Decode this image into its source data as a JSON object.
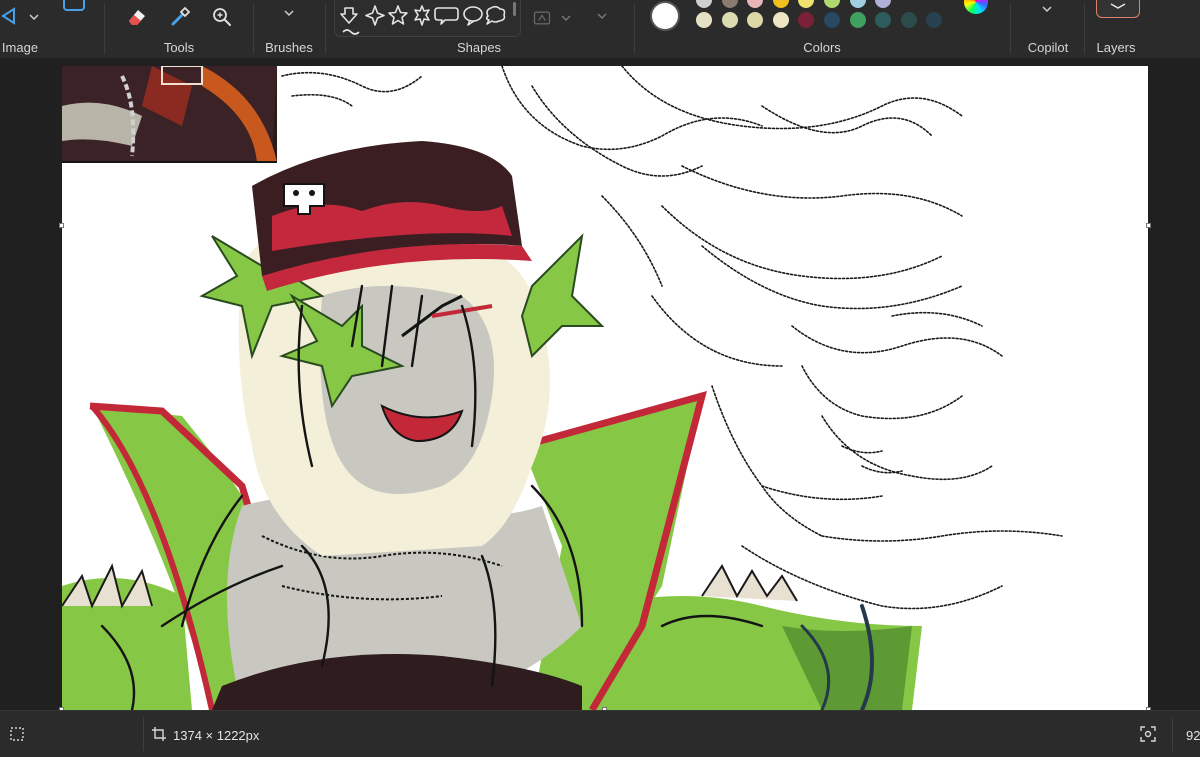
{
  "ribbon": {
    "groups": {
      "image": "Image",
      "tools": "Tools",
      "brushes": "Brushes",
      "shapes": "Shapes",
      "colors": "Colors",
      "copilot": "Copilot",
      "layers": "Layers"
    },
    "icons": {
      "image": [
        "select-icon",
        "image-icon"
      ],
      "tools": [
        "eraser-icon",
        "color-picker-icon",
        "magnifier-icon"
      ],
      "shapes": [
        "arrow-down-shape-icon",
        "star4-shape-icon",
        "star5-shape-icon",
        "star6-shape-icon",
        "callout-rect-icon",
        "callout-oval-icon",
        "callout-cloud-icon"
      ]
    },
    "colors": {
      "primary": "#ffffff",
      "row1": [
        "#cfcfcf",
        "#8a7a70",
        "#e7b5b8",
        "#f0c020",
        "#f0e070",
        "#b0d870",
        "#a0d0e0",
        "#b0b0d8"
      ],
      "row2": [
        "#e6e1c4",
        "#dcdab0",
        "#dcd9a6",
        "#ece6c4",
        "#7a2038",
        "#2a4860",
        "#40a060",
        "#2c5c5c",
        "#2c4c4c",
        "#284050"
      ]
    }
  },
  "status": {
    "canvas_size": "1374 × 1222px",
    "zoom": "92"
  },
  "canvas": {
    "background": "#ffffff",
    "palette": {
      "hat": "#3a1e22",
      "hat_red": "#c4283c",
      "skin": "#c8c8c0",
      "hair": "#f4efd8",
      "green": "#86c846",
      "green_dark": "#5e9a34",
      "coat_red": "#c22838",
      "shirt": "#2e1c1e",
      "ink": "#141414"
    }
  }
}
